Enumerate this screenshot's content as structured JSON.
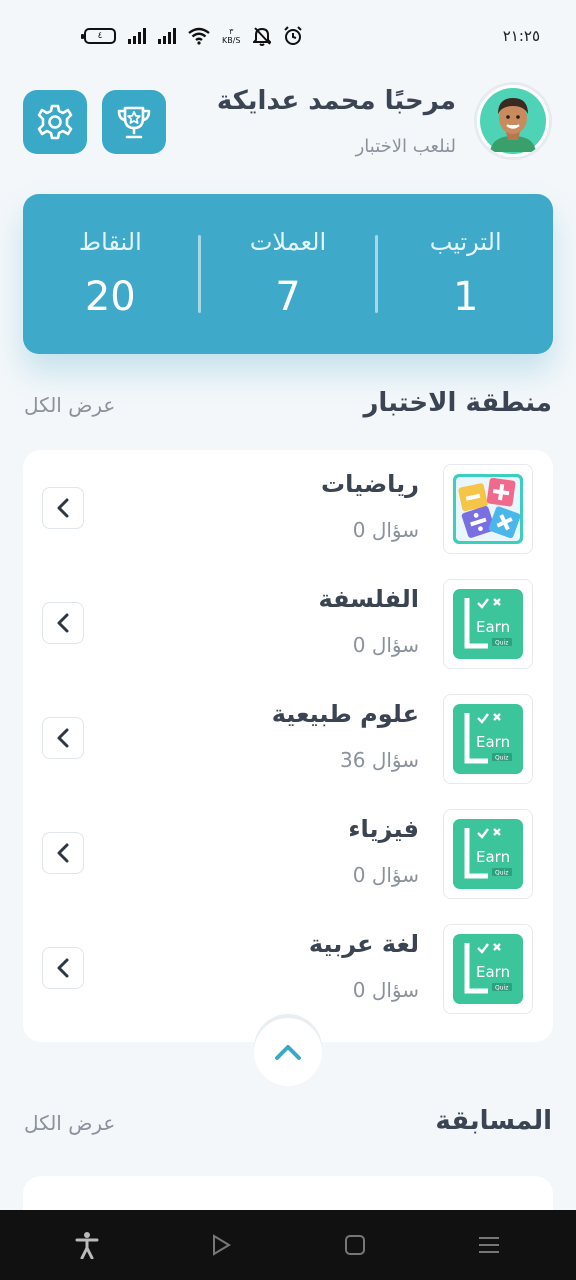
{
  "status_bar": {
    "time": "٢١:٢٥",
    "battery": "٤",
    "speed_value": "٣",
    "speed_unit": "KB/S"
  },
  "header": {
    "greeting": "مرحبًا محمد عدايكة",
    "subtitle": "لنلعب الاختبار"
  },
  "stats": {
    "rank_label": "الترتيب",
    "rank_value": "1",
    "coins_label": "العملات",
    "coins_value": "7",
    "points_label": "النقاط",
    "points_value": "20"
  },
  "quiz_section": {
    "title": "منطقة الاختبار",
    "view_all": "عرض الكل",
    "items": [
      {
        "title": "رياضيات",
        "count": "0 سؤال",
        "icon": "math-icon"
      },
      {
        "title": "الفلسفة",
        "count": "0 سؤال",
        "icon": "learn-quiz-icon"
      },
      {
        "title": "علوم طبيعية",
        "count": "36 سؤال",
        "icon": "learn-quiz-icon"
      },
      {
        "title": "فيزياء",
        "count": "0 سؤال",
        "icon": "learn-quiz-icon"
      },
      {
        "title": "لغة عربية",
        "count": "0 سؤال",
        "icon": "learn-quiz-icon"
      }
    ]
  },
  "competition_section": {
    "title": "المسابقة",
    "view_all": "عرض الكل"
  },
  "colors": {
    "accent": "#3fa9c9",
    "icon_green": "#3cc49a"
  }
}
